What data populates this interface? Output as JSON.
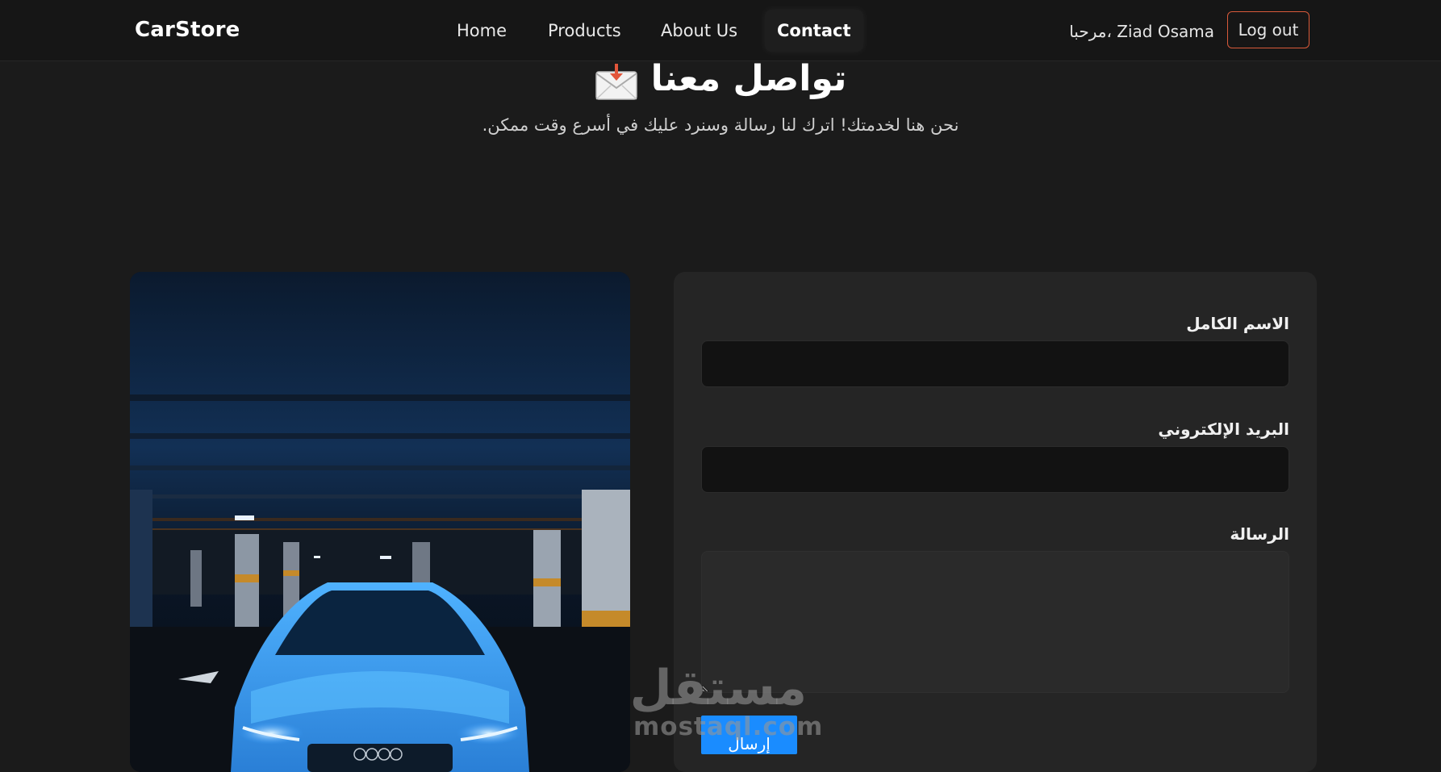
{
  "nav": {
    "brand": "CarStore",
    "links": [
      "Home",
      "Products",
      "About Us",
      "Contact"
    ],
    "active": "Contact",
    "greeting": "مرحبا، Ziad Osama",
    "logout": "Log out"
  },
  "header": {
    "title": "تواصل معنا",
    "title_icon": "envelope-icon",
    "subtitle": "نحن هنا لخدمتك! اترك لنا رسالة وسنرد عليك في أسرع وقت ممكن."
  },
  "hero_image": {
    "subject": "blue car in underground parking garage"
  },
  "form": {
    "name_label": "الاسم الكامل",
    "name_value": "",
    "email_label": "البريد الإلكتروني",
    "email_value": "",
    "message_label": "الرسالة",
    "message_value": "",
    "submit": "إرسال"
  },
  "watermark": {
    "arabic": "مستقل",
    "latin": "mostaql.com"
  },
  "colors": {
    "background": "#1b1b1b",
    "navbar": "#161616",
    "card": "#252525",
    "input": "#121212",
    "accent_button": "#1a8cff",
    "logout_border": "#d95a3a"
  }
}
